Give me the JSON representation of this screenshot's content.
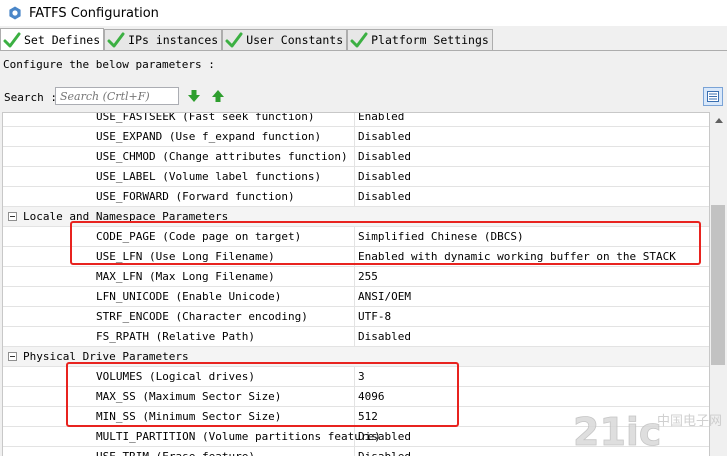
{
  "window": {
    "title": "FATFS Configuration"
  },
  "tabs": [
    {
      "label": "Set Defines",
      "active": true
    },
    {
      "label": "IPs instances",
      "active": false
    },
    {
      "label": "User Constants",
      "active": false
    },
    {
      "label": "Platform Settings",
      "active": false
    }
  ],
  "hint": "Configure the below parameters :",
  "search": {
    "label": "Search :",
    "placeholder": "Search (Crtl+F)",
    "value": ""
  },
  "rows": [
    {
      "kind": "param",
      "name": "USE_FASTSEEK (Fast seek function)",
      "value": "Enabled"
    },
    {
      "kind": "param",
      "name": "USE_EXPAND (Use f_expand function)",
      "value": "Disabled"
    },
    {
      "kind": "param",
      "name": "USE_CHMOD (Change attributes function)",
      "value": "Disabled"
    },
    {
      "kind": "param",
      "name": "USE_LABEL (Volume label functions)",
      "value": "Disabled"
    },
    {
      "kind": "param",
      "name": "USE_FORWARD (Forward function)",
      "value": "Disabled"
    },
    {
      "kind": "group",
      "name": "Locale and Namespace Parameters"
    },
    {
      "kind": "param",
      "name": "CODE_PAGE (Code page on target)",
      "value": "Simplified Chinese (DBCS)"
    },
    {
      "kind": "param",
      "name": "USE_LFN (Use Long Filename)",
      "value": "Enabled with dynamic working buffer on the STACK"
    },
    {
      "kind": "param",
      "name": "MAX_LFN (Max Long Filename)",
      "value": "255"
    },
    {
      "kind": "param",
      "name": "LFN_UNICODE (Enable Unicode)",
      "value": "ANSI/OEM"
    },
    {
      "kind": "param",
      "name": "STRF_ENCODE (Character encoding)",
      "value": "UTF-8"
    },
    {
      "kind": "param",
      "name": "FS_RPATH (Relative Path)",
      "value": "Disabled"
    },
    {
      "kind": "group",
      "name": "Physical Drive Parameters"
    },
    {
      "kind": "param",
      "name": "VOLUMES (Logical drives)",
      "value": "3"
    },
    {
      "kind": "param",
      "name": "MAX_SS (Maximum Sector Size)",
      "value": "4096"
    },
    {
      "kind": "param",
      "name": "MIN_SS (Minimum Sector Size)",
      "value": "512"
    },
    {
      "kind": "param",
      "name": "MULTI_PARTITION (Volume partitions feature)",
      "value": "Disabled"
    },
    {
      "kind": "param",
      "name": "USE_TRIM (Erase feature)",
      "value": "Disabled"
    }
  ],
  "watermark": {
    "text": "21ic",
    "subtext": "中国电子网"
  },
  "colors": {
    "highlight": "#e8231f",
    "check": "#3cb043",
    "arrow": "#2e9e2e"
  }
}
